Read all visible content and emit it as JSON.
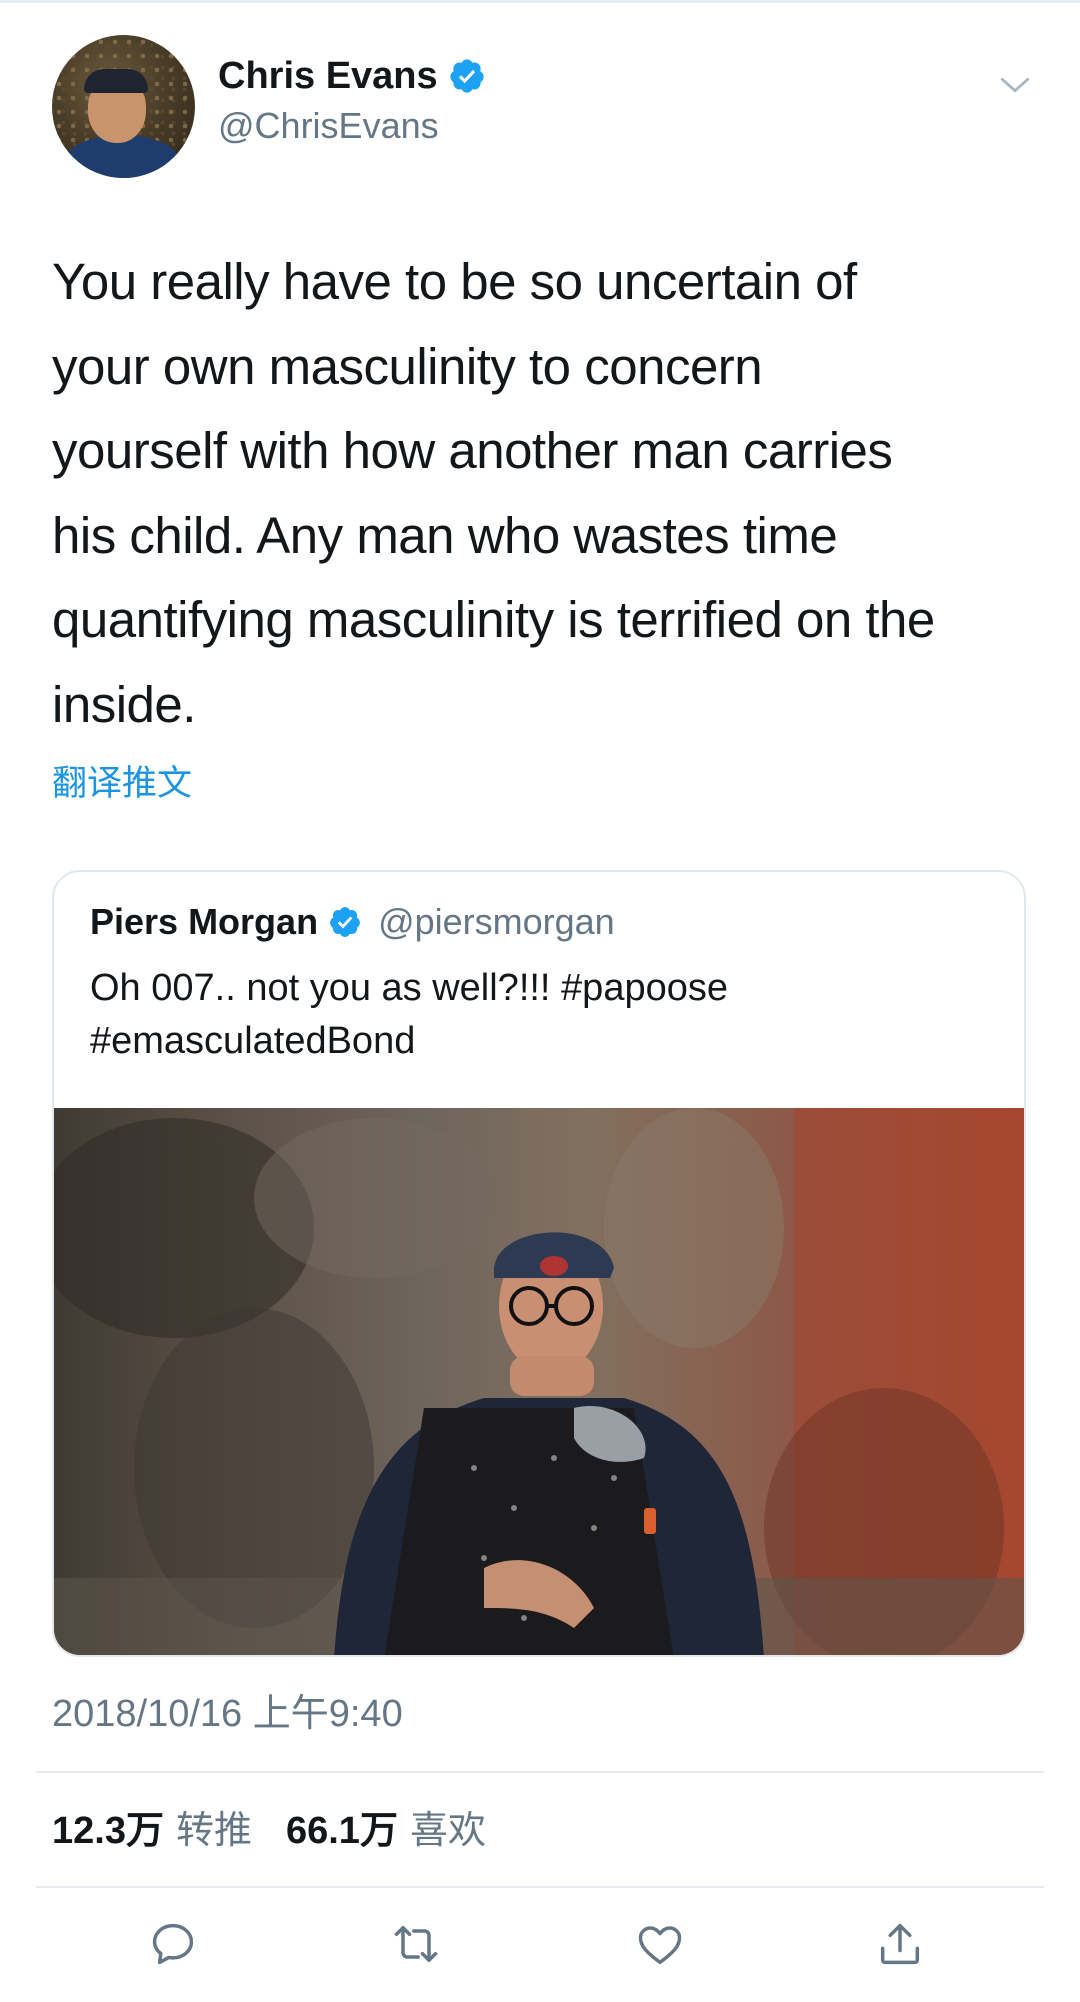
{
  "author": {
    "display_name": "Chris Evans",
    "handle": "@ChrisEvans",
    "verified": true
  },
  "tweet": {
    "text": "You really have to be so uncertain of\nyour own masculinity to concern\nyourself with how another man carries\nhis child. Any man who wastes time\nquantifying masculinity is terrified on the\ninside.",
    "translate_label": "翻译推文",
    "timestamp": "2018/10/16 上午9:40"
  },
  "quoted_tweet": {
    "display_name": "Piers Morgan",
    "handle": "@piersmorgan",
    "verified": true,
    "text": "Oh 007.. not you as well?!!! #papoose\n#emasculatedBond"
  },
  "stats": {
    "retweets_count": "12.3万",
    "retweets_label": "转推",
    "likes_count": "66.1万",
    "likes_label": "喜欢"
  },
  "actions": [
    "reply-icon",
    "retweet-icon",
    "like-icon",
    "share-icon"
  ],
  "colors": {
    "link_blue": "#1b95e0",
    "verified_blue": "#1da1f2",
    "secondary_text": "#657786",
    "border": "#e1e8ed"
  }
}
